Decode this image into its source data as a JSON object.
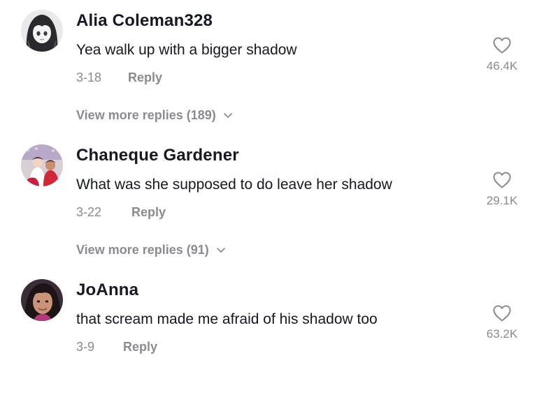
{
  "comments": [
    {
      "username": "Alia Coleman328",
      "text": "Yea walk up with a bigger shadow",
      "date": "3-18",
      "reply_label": "Reply",
      "likes": "46.4K",
      "view_more": "View more replies (189)",
      "avatar_icon": "avatar-anime-girl"
    },
    {
      "username": "Chaneque Gardener",
      "text": "What was she supposed to do leave her shadow",
      "date": "3-22",
      "reply_label": "Reply",
      "likes": "29.1K",
      "view_more": "View more replies (91)",
      "avatar_icon": "avatar-children-photo"
    },
    {
      "username": "JoAnna",
      "text": "that scream made me afraid of his shadow too",
      "date": "3-9",
      "reply_label": "Reply",
      "likes": "63.2K",
      "avatar_icon": "avatar-woman-photo"
    }
  ],
  "icons": {
    "like": "heart-outline-icon",
    "expand": "chevron-down-icon"
  },
  "colors": {
    "text_primary": "#161823",
    "text_secondary": "#8a8b91"
  }
}
